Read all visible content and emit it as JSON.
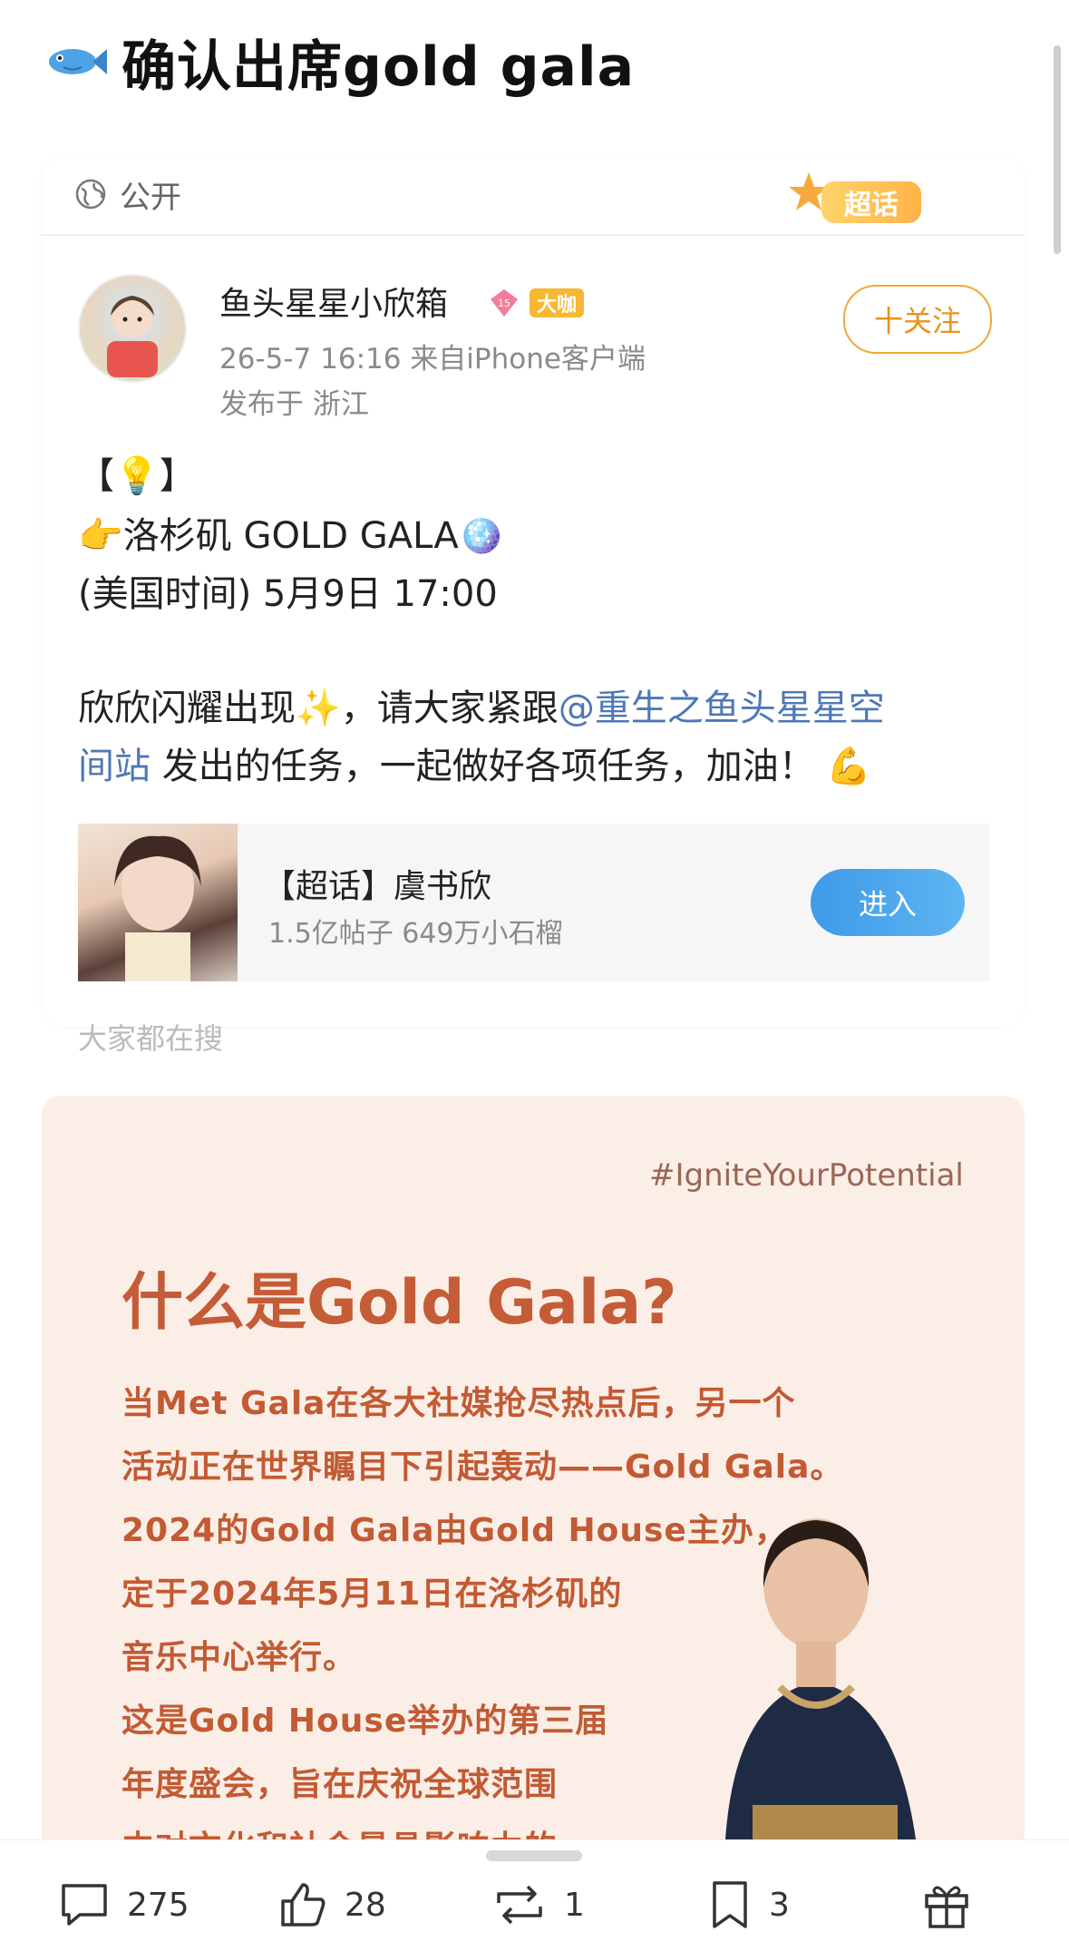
{
  "post_title": {
    "emoji": "fish-icon",
    "text": "确认出席gold gala"
  },
  "card": {
    "visibility": "公开",
    "topic_badge": "超话",
    "author": {
      "name": "鱼头星星小欣箱",
      "level": "15",
      "badge": "大咖",
      "meta_time": "26-5-7 16:16  来自iPhone客户端",
      "meta_location": "发布于 浙江"
    },
    "follow_label": "十关注",
    "body": {
      "line1": "【💡】",
      "line2": "👉洛杉矶 GOLD GALA🪩",
      "line3": "(美国时间) 5月9日 17:00",
      "line4_before": "欣欣闪耀出现✨，请大家紧跟",
      "line4_mention": "@重生之鱼头星星空",
      "line5_mention": "间站",
      "line5_after": " 发出的任务，一起做好各项任务，加油！ 💪"
    },
    "topic": {
      "title": "【超话】虞书欣",
      "stats": "1.5亿帖子 649万小石榴",
      "enter_label": "进入"
    },
    "faded_text": "大家都在搜"
  },
  "poster": {
    "hashtag": "#IgniteYourPotential",
    "title": "什么是Gold Gala?",
    "lines": [
      "当Met Gala在各大社媒抢尽热点后，另一个",
      "活动正在世界瞩目下引起轰动——Gold Gala。",
      "2024的Gold Gala由Gold House主办，",
      "定于2024年5月11日在洛杉矶的",
      "音乐中心举行。",
      "这是Gold House举办的第三届",
      "年度盛会，旨在庆祝全球范围",
      "内对文化和社会最具影响力的"
    ],
    "accent_color": "#c45c37",
    "background_color": "#fbeee6"
  },
  "bottom_bar": {
    "comments": "275",
    "likes": "28",
    "reposts": "1",
    "favorites": "3"
  }
}
